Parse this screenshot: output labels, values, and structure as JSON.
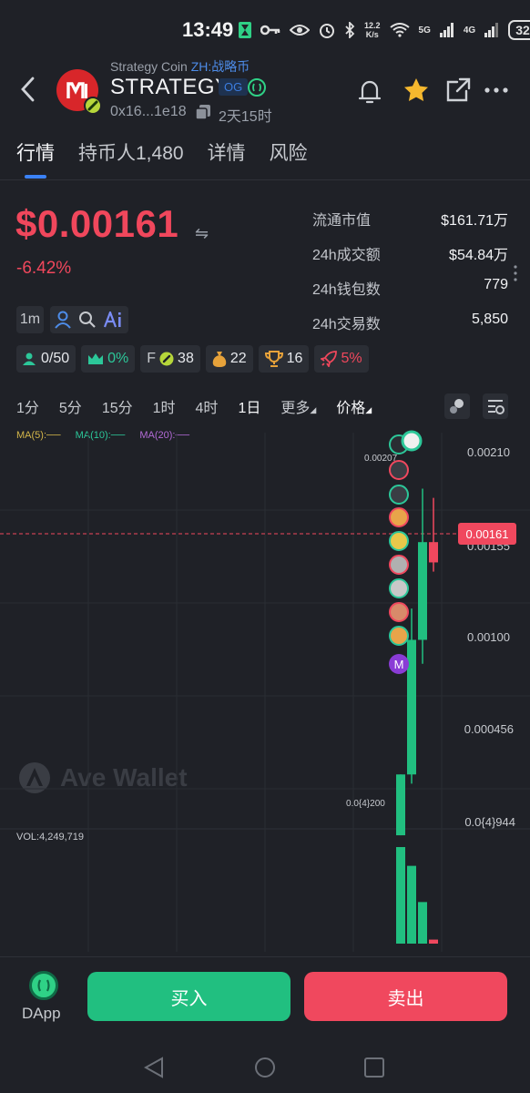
{
  "status_bar": {
    "time": "13:49",
    "speed_top": "12.2",
    "speed_unit": "K/s",
    "net1": "5G",
    "net2": "4G",
    "battery": "32"
  },
  "header": {
    "subname_en": "Strategy Coin",
    "subname_zh": "ZH:战略币",
    "token_name": "STRATEGY",
    "og_tag": "OG",
    "address": "0x16...1e18",
    "age": "2天15时"
  },
  "tabs": [
    {
      "label": "行情",
      "active": true
    },
    {
      "label": "持币人1,480",
      "active": false
    },
    {
      "label": "详情",
      "active": false
    },
    {
      "label": "风险",
      "active": false
    }
  ],
  "price": {
    "value": "$0.00161",
    "change": "-6.42%"
  },
  "stats": [
    {
      "label": "流通市值",
      "value": "$161.71万"
    },
    {
      "label": "24h成交额",
      "value": "$54.84万"
    },
    {
      "label": "24h钱包数",
      "value": "779"
    },
    {
      "label": "24h交易数",
      "value": "5,850"
    }
  ],
  "tools": {
    "interval_chip": "1m"
  },
  "badges": [
    {
      "icon": "holder-icon",
      "value": "0/50",
      "color": "#2cc799"
    },
    {
      "icon": "crown-icon",
      "value": "0%",
      "color": "#2cc799"
    },
    {
      "icon": "f-icon",
      "prefix": "F",
      "value": "38",
      "color": "#e6e8ec"
    },
    {
      "icon": "moneybag-icon",
      "value": "22",
      "color": "#e6e8ec"
    },
    {
      "icon": "trophy-icon",
      "value": "16",
      "color": "#e6e8ec"
    },
    {
      "icon": "rocket-icon",
      "value": "5%",
      "color": "#f0475c"
    }
  ],
  "timeframes": [
    {
      "label": "1分",
      "active": false
    },
    {
      "label": "5分",
      "active": false
    },
    {
      "label": "15分",
      "active": false
    },
    {
      "label": "1时",
      "active": false
    },
    {
      "label": "4时",
      "active": false
    },
    {
      "label": "1日",
      "active": true
    },
    {
      "label": "更多",
      "active": false
    },
    {
      "label": "价格",
      "active": false
    }
  ],
  "ma_legend": {
    "ma5": "MA(5):",
    "ma10": "MA(10):",
    "ma20": "MA(20):"
  },
  "chart": {
    "y_labels": [
      "0.00210",
      "0.00155",
      "0.00100",
      "0.000456",
      "0.0{4}944"
    ],
    "high_label": "0.00207",
    "low_label": "0.0{4}200",
    "current_price_tag": "0.00161",
    "volume_label": "VOL:4,249,719",
    "marker_letter": "M",
    "watermark": "Ave Wallet",
    "colors": {
      "up": "#21bf80",
      "down": "#f0485e"
    }
  },
  "chart_data": {
    "type": "candlestick",
    "candles": [
      {
        "open": 2e-05,
        "close": 0.00035,
        "high": 0.00035,
        "low": 2e-05
      },
      {
        "open": 0.00035,
        "close": 0.00108,
        "high": 0.00125,
        "low": 0.0003
      },
      {
        "open": 0.00108,
        "close": 0.00161,
        "high": 0.0019,
        "low": 0.00095
      },
      {
        "open": 0.00161,
        "close": 0.0015,
        "high": 0.00185,
        "low": 0.00145
      }
    ],
    "volumes": [
      3600000,
      2900000,
      1550000,
      150000
    ],
    "volume_label": "VOL:4,249,719",
    "current": 0.00161
  },
  "bottom": {
    "dapp_label": "DApp",
    "buy_label": "买入",
    "sell_label": "卖出"
  }
}
